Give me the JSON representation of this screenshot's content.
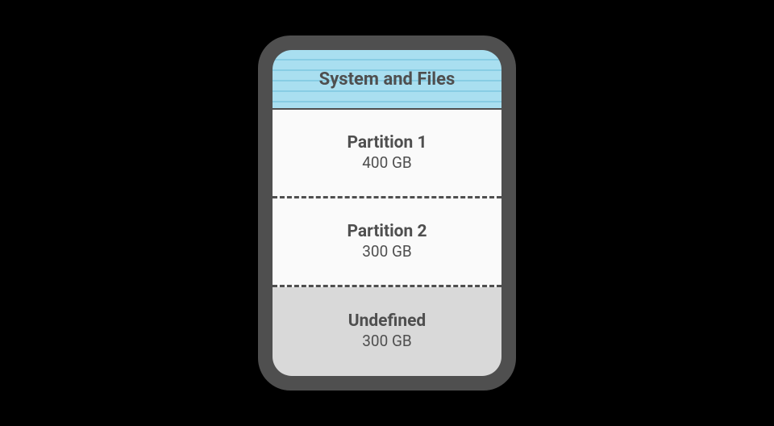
{
  "header": {
    "title": "System and Files"
  },
  "partitions": [
    {
      "name": "Partition 1",
      "size": "400 GB"
    },
    {
      "name": "Partition 2",
      "size": "300 GB"
    },
    {
      "name": "Undefined",
      "size": "300 GB"
    }
  ]
}
